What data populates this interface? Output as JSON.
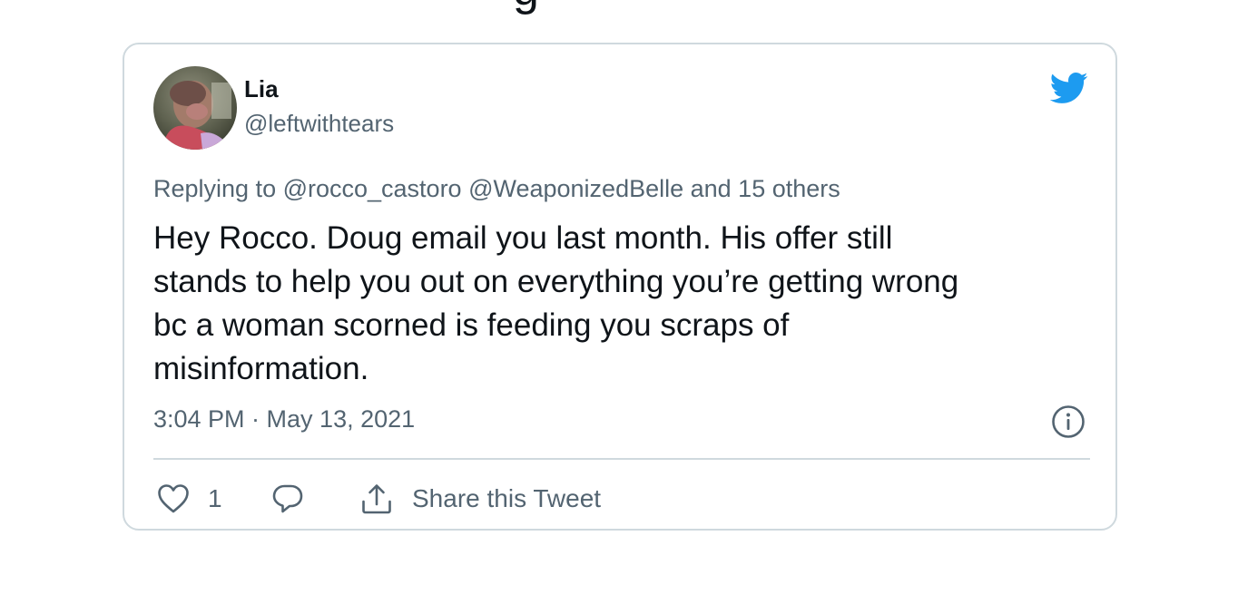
{
  "header_fragment": "g",
  "tweet": {
    "author": {
      "display_name": "Lia",
      "handle": "@leftwithtears",
      "avatar_icon": "profile-photo"
    },
    "brand_icon": "twitter-bird-icon",
    "replying_to": "Replying to @rocco_castoro @WeaponizedBelle and 15 others",
    "text": "Hey Rocco. Doug email you last month. His offer still\nstands to help you out on everything you’re getting wrong\nbc a woman scorned is feeding you scraps of\nmisinformation.",
    "timestamp": "3:04 PM · May 13, 2021",
    "actions": {
      "like_count": "1",
      "share_label": "Share this Tweet"
    }
  },
  "colors": {
    "twitter_blue": "#1d9bf0",
    "text_primary": "#0f1419",
    "text_secondary": "#536471",
    "border": "#cfd9de"
  }
}
